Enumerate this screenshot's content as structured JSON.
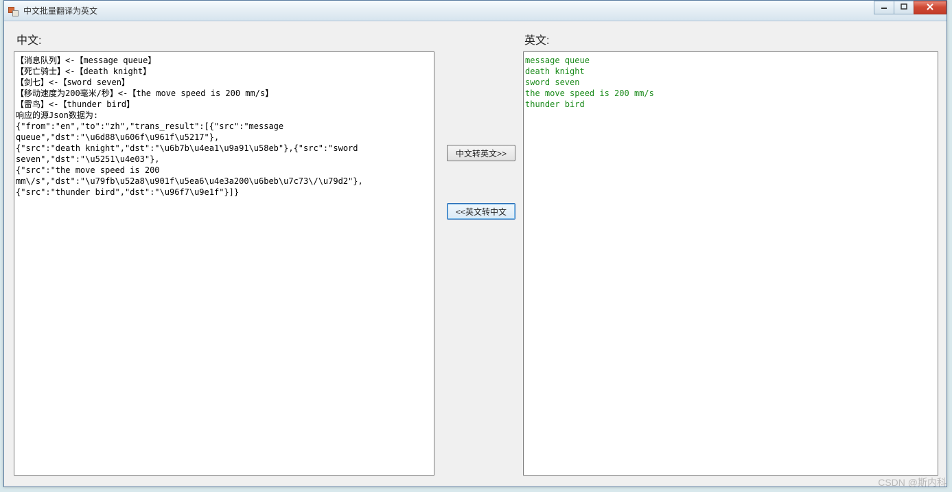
{
  "window": {
    "title": "中文批量翻译为英文"
  },
  "labels": {
    "chinese": "中文:",
    "english": "英文:"
  },
  "buttons": {
    "cn2en": "中文转英文>>",
    "en2cn": "<<英文转中文"
  },
  "chinese_text": "【消息队列】<-【message queue】\n【死亡骑士】<-【death knight】\n【剑七】<-【sword seven】\n【移动速度为200毫米/秒】<-【the move speed is 200 mm/s】\n【雷鸟】<-【thunder bird】\n响应的源Json数据为:\n{\"from\":\"en\",\"to\":\"zh\",\"trans_result\":[{\"src\":\"message queue\",\"dst\":\"\\u6d88\\u606f\\u961f\\u5217\"},\n{\"src\":\"death knight\",\"dst\":\"\\u6b7b\\u4ea1\\u9a91\\u58eb\"},{\"src\":\"sword seven\",\"dst\":\"\\u5251\\u4e03\"},\n{\"src\":\"the move speed is 200 mm\\/s\",\"dst\":\"\\u79fb\\u52a8\\u901f\\u5ea6\\u4e3a200\\u6beb\\u7c73\\/\\u79d2\"},\n{\"src\":\"thunder bird\",\"dst\":\"\\u96f7\\u9e1f\"}]}",
  "english_text": "message queue\ndeath knight\nsword seven\nthe move speed is 200 mm/s\nthunder bird",
  "watermark": "CSDN @斯内科"
}
